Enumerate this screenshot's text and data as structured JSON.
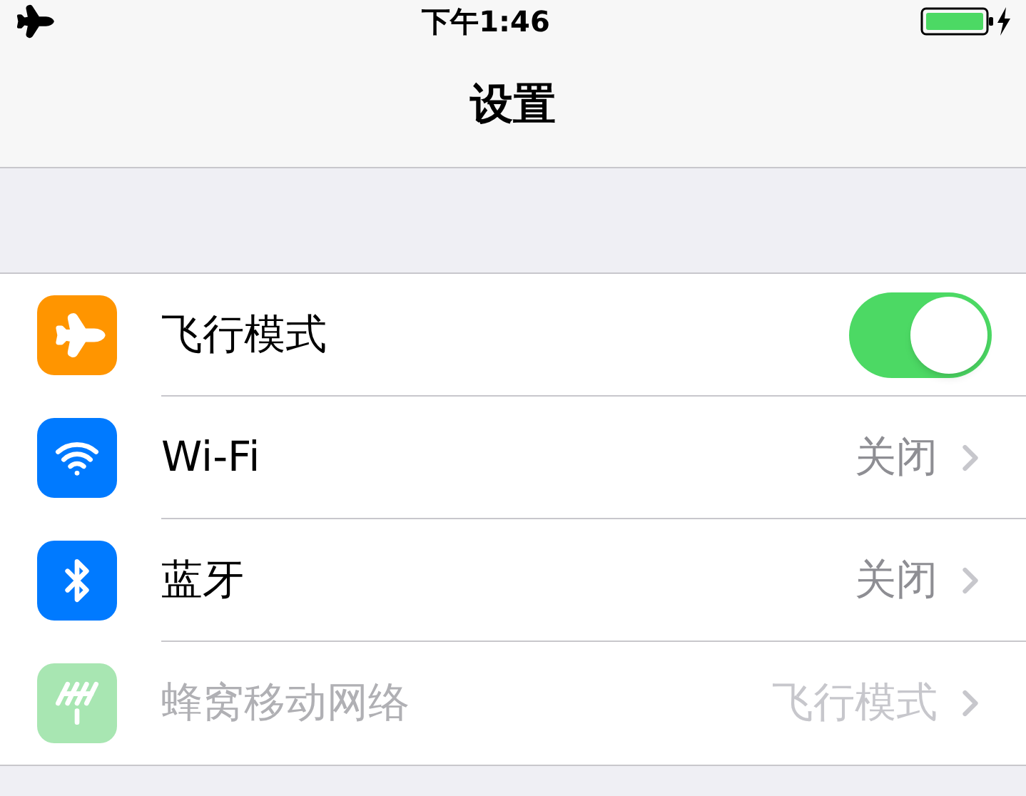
{
  "status_bar": {
    "time": "下午1:46"
  },
  "nav": {
    "title": "设置"
  },
  "rows": [
    {
      "kind": "toggle",
      "color": "#ff9500",
      "label": "飞行模式",
      "on": true,
      "disabled": false
    },
    {
      "kind": "link",
      "color": "#007aff",
      "label": "Wi-Fi",
      "value": "关闭",
      "disabled": false
    },
    {
      "kind": "link",
      "color": "#007aff",
      "label": "蓝牙",
      "value": "关闭",
      "disabled": false
    },
    {
      "kind": "link",
      "color": "#a8e6b2",
      "label": "蜂窝移动网络",
      "value": "飞行模式",
      "disabled": true
    }
  ]
}
